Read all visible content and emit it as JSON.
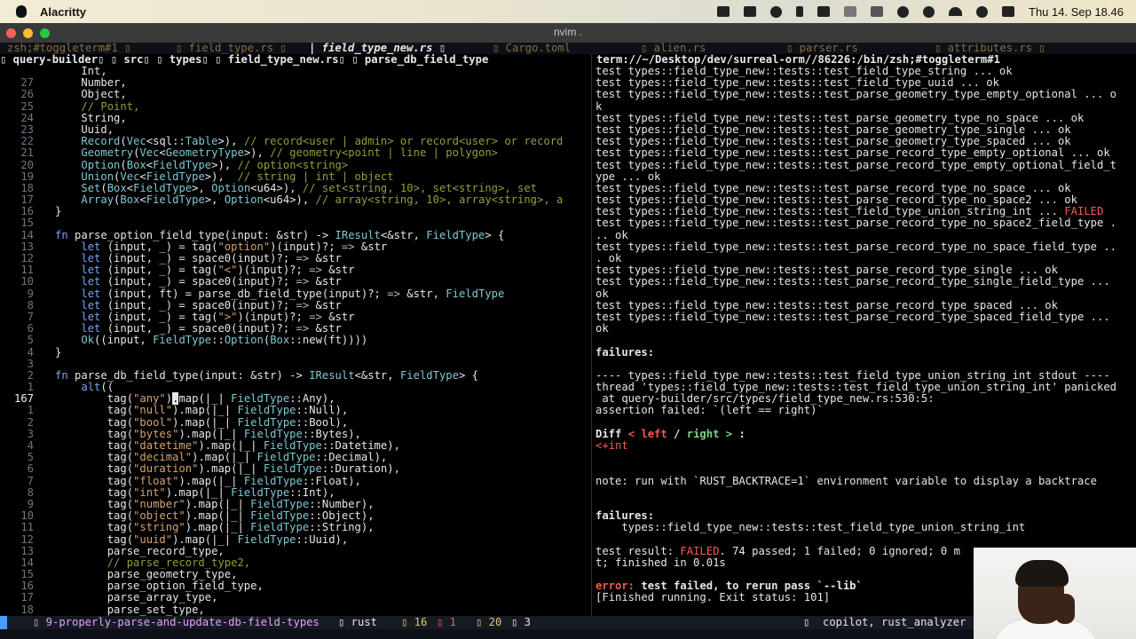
{
  "menubar": {
    "app_name": "Alacritty",
    "clock": "Thu 14. Sep 18.46"
  },
  "window": {
    "title": "nvim ."
  },
  "tabline": {
    "tabs": [
      {
        "label": "zsh;#toggleterm#1 ▯",
        "active": false
      },
      {
        "label": "▯ field_type.rs ▯",
        "active": false
      },
      {
        "label": "| field_type_new.rs ▯",
        "active": true
      },
      {
        "label": "▯ Cargo.toml",
        "active": false
      },
      {
        "label": "▯ alien.rs",
        "active": false
      },
      {
        "label": "▯ parser.rs",
        "active": false
      },
      {
        "label": "▯ attributes.rs ▯",
        "active": false
      }
    ]
  },
  "winbar": {
    "text": "▯ query-builder▯ ▯ src▯ ▯ types▯ ▯ field_type_new.rs▯ ▯ parse_db_field_type"
  },
  "terminal_title": "term://~/Desktop/dev/surreal-orm//86226:/bin/zsh;#toggleterm#1",
  "editor": {
    "lines": [
      {
        "ln": "",
        "code": "    Int,"
      },
      {
        "ln": "27",
        "code": "    Number,"
      },
      {
        "ln": "26",
        "code": "    Object,"
      },
      {
        "ln": "25",
        "code": "    // Point,"
      },
      {
        "ln": "24",
        "code": "    String,"
      },
      {
        "ln": "23",
        "code": "    Uuid,"
      },
      {
        "ln": "22",
        "code": "    Record(Vec<sql::Table>), // record<user | admin> or record<user> or record"
      },
      {
        "ln": "21",
        "code": "    Geometry(Vec<GeometryType>), // geometry<point | line | polygon>"
      },
      {
        "ln": "20",
        "code": "    Option(Box<FieldType>), // option<string>"
      },
      {
        "ln": "19",
        "code": "    Union(Vec<FieldType>),  // string | int | object"
      },
      {
        "ln": "18",
        "code": "    Set(Box<FieldType>, Option<u64>), // set<string, 10>, set<string>, set"
      },
      {
        "ln": "17",
        "code": "    Array(Box<FieldType>, Option<u64>), // array<string, 10>, array<string>, a"
      },
      {
        "ln": "16",
        "code": "}"
      },
      {
        "ln": "15",
        "code": ""
      },
      {
        "ln": "14",
        "code": "fn parse_option_field_type(input: &str) -> IResult<&str, FieldType> {"
      },
      {
        "ln": "13",
        "code": "    let (input, _) = tag(\"option\")(input)?; => &str"
      },
      {
        "ln": "12",
        "code": "    let (input, _) = space0(input)?; => &str"
      },
      {
        "ln": "11",
        "code": "    let (input, _) = tag(\"<\")(input)?; => &str"
      },
      {
        "ln": "10",
        "code": "    let (input, _) = space0(input)?; => &str"
      },
      {
        "ln": "9",
        "code": "    let (input, ft) = parse_db_field_type(input)?; => &str, FieldType"
      },
      {
        "ln": "8",
        "code": "    let (input, _) = space0(input)?; => &str"
      },
      {
        "ln": "7",
        "code": "    let (input, _) = tag(\">\")(input)?; => &str"
      },
      {
        "ln": "6",
        "code": "    let (input, _) = space0(input)?; => &str"
      },
      {
        "ln": "5",
        "code": "    Ok((input, FieldType::Option(Box::new(ft))))"
      },
      {
        "ln": "4",
        "code": "}"
      },
      {
        "ln": "3",
        "code": ""
      },
      {
        "ln": "2",
        "code": "fn parse_db_field_type(input: &str) -> IResult<&str, FieldType> {"
      },
      {
        "ln": "1",
        "code": "    alt(("
      },
      {
        "ln": "167",
        "code": "        tag(\"any\").map(|_| FieldType::Any),"
      },
      {
        "ln": "1",
        "code": "        tag(\"null\").map(|_| FieldType::Null),"
      },
      {
        "ln": "2",
        "code": "        tag(\"bool\").map(|_| FieldType::Bool),"
      },
      {
        "ln": "3",
        "code": "        tag(\"bytes\").map(|_| FieldType::Bytes),"
      },
      {
        "ln": "4",
        "code": "        tag(\"datetime\").map(|_| FieldType::Datetime),"
      },
      {
        "ln": "5",
        "code": "        tag(\"decimal\").map(|_| FieldType::Decimal),"
      },
      {
        "ln": "6",
        "code": "        tag(\"duration\").map(|_| FieldType::Duration),"
      },
      {
        "ln": "7",
        "code": "        tag(\"float\").map(|_| FieldType::Float),"
      },
      {
        "ln": "8",
        "code": "        tag(\"int\").map(|_| FieldType::Int),"
      },
      {
        "ln": "9",
        "code": "        tag(\"number\").map(|_| FieldType::Number),"
      },
      {
        "ln": "10",
        "code": "        tag(\"object\").map(|_| FieldType::Object),"
      },
      {
        "ln": "11",
        "code": "        tag(\"string\").map(|_| FieldType::String),"
      },
      {
        "ln": "12",
        "code": "        tag(\"uuid\").map(|_| FieldType::Uuid),"
      },
      {
        "ln": "13",
        "code": "        parse_record_type,"
      },
      {
        "ln": "14",
        "code": "        // parse_record_type2,"
      },
      {
        "ln": "15",
        "code": "        parse_geometry_type,"
      },
      {
        "ln": "16",
        "code": "        parse_option_field_type,"
      },
      {
        "ln": "17",
        "code": "        parse_array_type,"
      },
      {
        "ln": "18",
        "code": "        parse_set_type,"
      }
    ]
  },
  "terminal": {
    "lines": [
      "test types::field_type_new::tests::test_field_type_string ... ok",
      "test types::field_type_new::tests::test_field_type_uuid ... ok",
      "test types::field_type_new::tests::test_parse_geometry_type_empty_optional ... o",
      "k",
      "test types::field_type_new::tests::test_parse_geometry_type_no_space ... ok",
      "test types::field_type_new::tests::test_parse_geometry_type_single ... ok",
      "test types::field_type_new::tests::test_parse_geometry_type_spaced ... ok",
      "test types::field_type_new::tests::test_parse_record_type_empty_optional ... ok",
      "test types::field_type_new::tests::test_parse_record_type_empty_optional_field_t",
      "ype ... ok",
      "test types::field_type_new::tests::test_parse_record_type_no_space ... ok",
      "test types::field_type_new::tests::test_parse_record_type_no_space2 ... ok",
      "test types::field_type_new::tests::test_field_type_union_string_int ... FAILED",
      "test types::field_type_new::tests::test_parse_record_type_no_space2_field_type .",
      ".. ok",
      "test types::field_type_new::tests::test_parse_record_type_no_space_field_type ..",
      ". ok",
      "test types::field_type_new::tests::test_parse_record_type_single ... ok",
      "test types::field_type_new::tests::test_parse_record_type_single_field_type ...",
      "ok",
      "test types::field_type_new::tests::test_parse_record_type_spaced ... ok",
      "test types::field_type_new::tests::test_parse_record_type_spaced_field_type ...",
      "ok",
      "",
      "failures:",
      "",
      "---- types::field_type_new::tests::test_field_type_union_string_int stdout ----",
      "thread 'types::field_type_new::tests::test_field_type_union_string_int' panicked",
      " at query-builder/src/types/field_type_new.rs:530:5:",
      "assertion failed: `(left == right)`",
      "",
      "Diff < left / right > :",
      "<+int",
      "",
      "",
      "note: run with `RUST_BACKTRACE=1` environment variable to display a backtrace",
      "",
      "",
      "failures:",
      "    types::field_type_new::tests::test_field_type_union_string_int",
      "",
      "test result: FAILED. 74 passed; 1 failed; 0 ignored; 0 m",
      "t; finished in 0.01s",
      "",
      "error: test failed, to rerun pass `--lib`",
      "[Finished running. Exit status: 101]"
    ]
  },
  "statusline": {
    "branch": "▯ 9-properly-parse-and-update-db-field-types",
    "filetype": "▯ rust",
    "diag1": "▯ 16",
    "diag2": "▯ 1",
    "diag3": "▯ 20",
    "diag4": "▯ 3",
    "lsp": "▯  copilot, rust_analyzer"
  },
  "colors": {
    "keyword": "#7aa2f7",
    "type": "#7fc8d4",
    "string": "#d4a373",
    "comment": "#8aa03a",
    "failed": "#f25c54",
    "background": "#000000"
  }
}
